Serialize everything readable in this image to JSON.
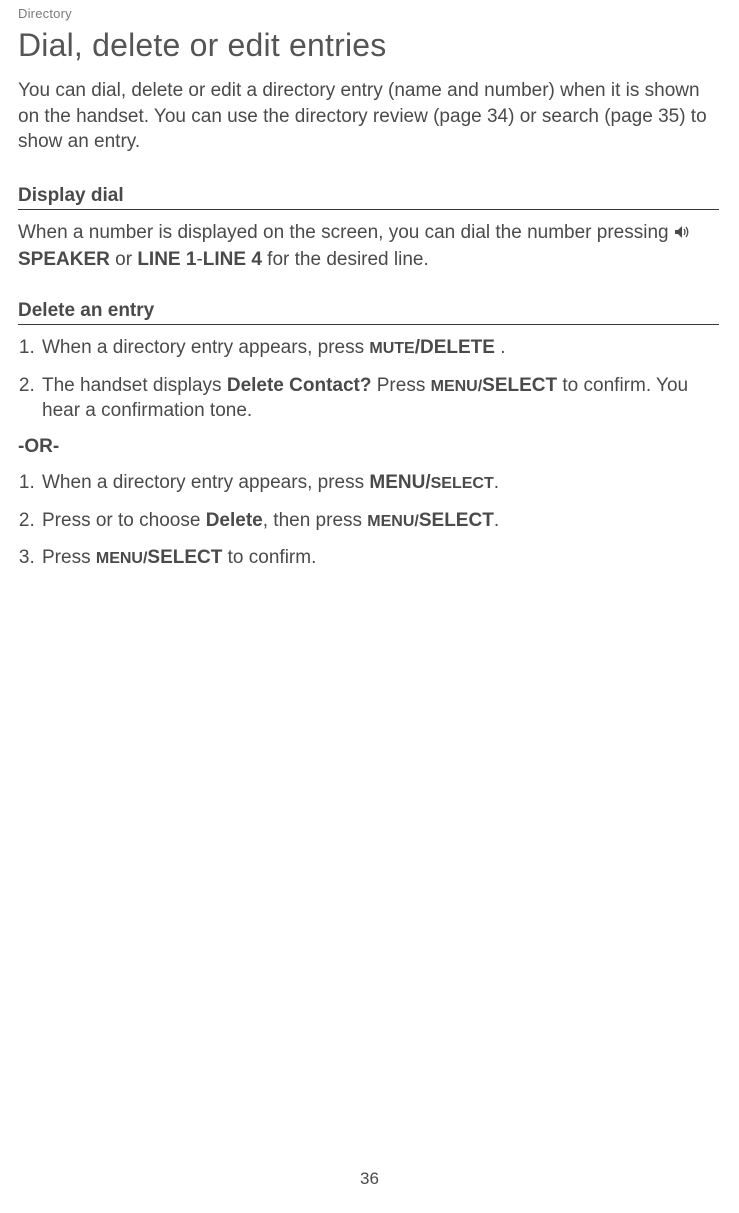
{
  "breadcrumb": "Directory",
  "title": "Dial, delete or edit entries",
  "intro": "You can dial, delete or edit a directory entry (name and number) when it is shown on the handset. You can use the directory review (page 34) or search (page 35) to show an entry.",
  "section1": {
    "heading": "Display dial",
    "body_pre": "When a number is displayed on the screen, you can dial the number pressing ",
    "speaker_label": "SPEAKER",
    "body_mid": " or ",
    "line_label": "LINE 1",
    "dash": "-",
    "line_label2": "LINE 4",
    "body_post": " for the desired line."
  },
  "section2": {
    "heading": "Delete an entry",
    "list_a": {
      "item1_pre": "When a directory entry appears, press ",
      "item1_key_small": "MUTE",
      "item1_key_big": "/DELETE",
      "item1_post": " .",
      "item2_pre": "The handset displays ",
      "item2_bold": "Delete Contact?",
      "item2_mid": " Press ",
      "item2_key_small": "MENU/",
      "item2_key_big": "SELECT",
      "item2_post": " to confirm. You hear a confirmation tone."
    },
    "or_label": "-OR-",
    "list_b": {
      "item1_pre": "When a directory entry appears, press ",
      "item1_key_big": "MENU/",
      "item1_key_small": "SELECT",
      "item1_post": ".",
      "item2_pre": "Press or to choose ",
      "item2_bold": "Delete",
      "item2_mid": ", then press ",
      "item2_key_small": "MENU/",
      "item2_key_big": "SELECT",
      "item2_post": ".",
      "item3_pre": "Press ",
      "item3_key_small": "MENU/",
      "item3_key_big": "SELECT",
      "item3_post": " to confirm."
    }
  },
  "page_number": "36"
}
